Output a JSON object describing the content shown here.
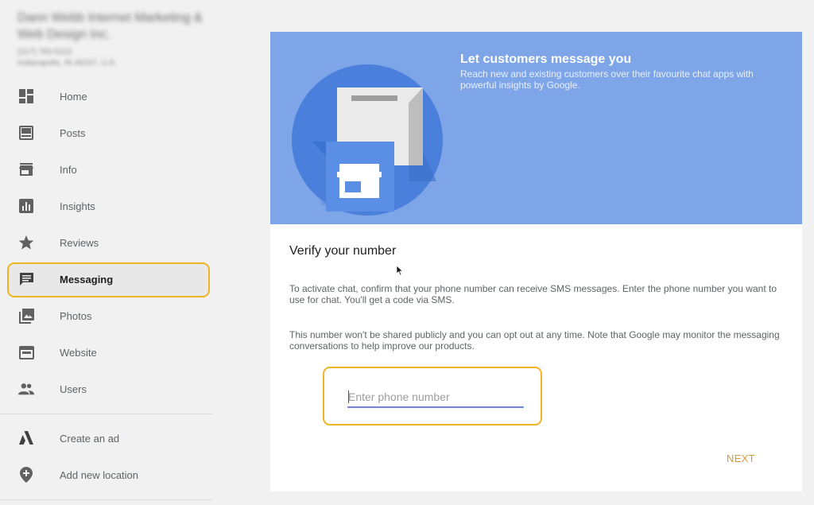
{
  "business": {
    "name": "Dann Webb Internet Marketing & Web Design Inc.",
    "phone": "(317) 783-5222",
    "address": "Indianapolis, IN 46237, U.S."
  },
  "sidebar": {
    "items": [
      {
        "label": "Home",
        "icon": "dashboard-icon"
      },
      {
        "label": "Posts",
        "icon": "posts-icon"
      },
      {
        "label": "Info",
        "icon": "store-icon"
      },
      {
        "label": "Insights",
        "icon": "insights-icon"
      },
      {
        "label": "Reviews",
        "icon": "star-icon"
      },
      {
        "label": "Messaging",
        "icon": "chat-icon",
        "active": true
      },
      {
        "label": "Photos",
        "icon": "photos-icon"
      },
      {
        "label": "Website",
        "icon": "website-icon"
      },
      {
        "label": "Users",
        "icon": "users-icon"
      }
    ],
    "secondary": [
      {
        "label": "Create an ad",
        "icon": "ads-icon"
      },
      {
        "label": "Add new location",
        "icon": "location-pin-icon"
      }
    ]
  },
  "hero": {
    "title": "Let customers message you",
    "subtitle": "Reach new and existing customers over their favourite chat apps with powerful insights by Google."
  },
  "verify": {
    "title": "Verify your number",
    "para1": "To activate chat, confirm that your phone number can receive SMS messages. Enter the phone number you want to use for chat. You'll get a code via SMS.",
    "para2": "This number won't be shared publicly and you can opt out at any time. Note that Google may monitor the messaging conversations to help improve our products.",
    "phone_placeholder": "Enter phone number",
    "phone_value": "",
    "next_label": "NEXT"
  },
  "colors": {
    "hero_bg": "#7da5e7",
    "highlight": "#f0b323",
    "accent_text": "#d59a3a"
  }
}
